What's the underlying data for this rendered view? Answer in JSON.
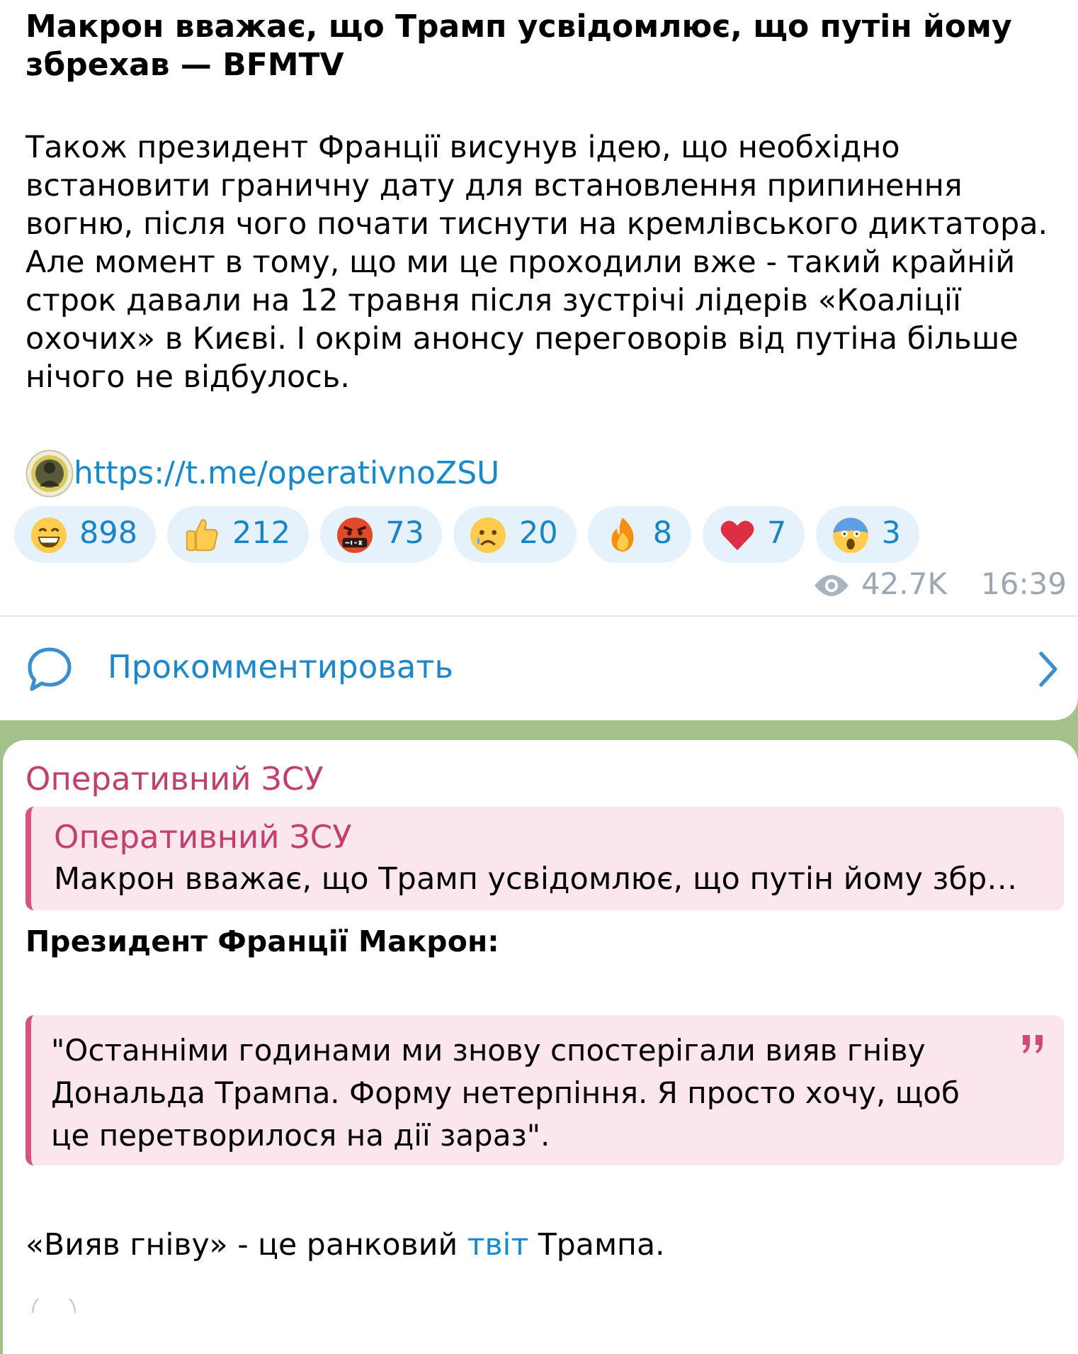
{
  "post": {
    "title": "Макрон вважає, що Трамп усвідомлює, що путін йому збрехав — BFMTV",
    "text": "Також президент Франції висунув ідею, що необхідно встановити граничну дату для встановлення припинення вогню, після чого почати тиснути на кремлівського диктатора. Але момент в тому, що ми це проходили вже - такий крайній строк давали на 12 травня після зустрічі лідерів «Коаліції охочих» в Києві. І окрім анонсу переговорів від путіна більше нічого не відбулось.",
    "link": "https://t.me/operativnoZSU",
    "reactions": [
      {
        "kind": "grin",
        "count": "898",
        "selected": false
      },
      {
        "kind": "thumbs_up",
        "count": "212",
        "selected": false
      },
      {
        "kind": "cursing",
        "count": "73",
        "selected": false
      },
      {
        "kind": "crying",
        "count": "20",
        "selected": false
      },
      {
        "kind": "fire",
        "count": "8",
        "selected": false
      },
      {
        "kind": "heart",
        "count": "7",
        "selected": false
      },
      {
        "kind": "scream",
        "count": "3",
        "selected": false
      }
    ],
    "views": "42.7K",
    "time": "16:39",
    "comment_button": "Прокомментировать"
  },
  "next_post": {
    "sender": "Оперативний ЗСУ",
    "reply": {
      "sender": "Оперативний ЗСУ",
      "text": "Макрон вважає, що Трамп усвідомлює, що путін йому збр…"
    },
    "lead": "Президент Франції Макрон:",
    "quote": "\"Останніми годинами ми знову спостерігали вияв гніву Дональда Трампа. Форму нетерпіння. Я просто хочу, щоб це перетворилося на дії зараз\".",
    "closing": [
      {
        "kind": "plain",
        "text": "«Вияв гніву» - це ранковий"
      },
      {
        "kind": "link",
        "text": "твіт"
      },
      {
        "kind": "plain",
        "text": "Трампа."
      }
    ]
  }
}
